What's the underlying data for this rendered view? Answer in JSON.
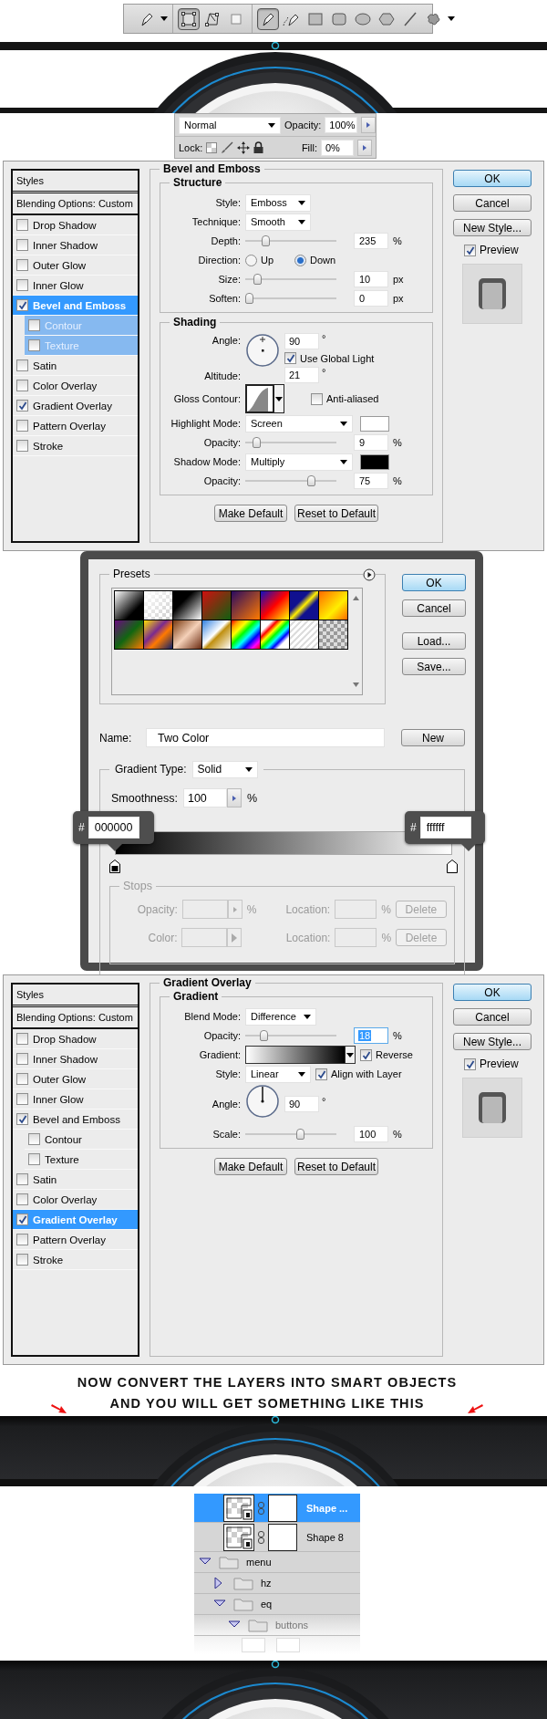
{
  "tool_options_bar": {
    "tool_groups": [
      {
        "tools": [
          {
            "kind": "pen-menu",
            "selected": false
          }
        ]
      },
      {
        "tools": [
          {
            "kind": "shape-layers",
            "selected": true
          },
          {
            "kind": "paths",
            "selected": false
          },
          {
            "kind": "fill-pixels",
            "selected": false
          }
        ]
      },
      {
        "tools": [
          {
            "kind": "pen",
            "selected": true
          },
          {
            "kind": "freeform-pen",
            "selected": false
          },
          {
            "kind": "rectangle",
            "selected": false
          },
          {
            "kind": "rounded-rectangle",
            "selected": false
          },
          {
            "kind": "ellipse",
            "selected": false
          },
          {
            "kind": "polygon",
            "selected": false
          },
          {
            "kind": "line",
            "selected": false
          },
          {
            "kind": "custom-shape",
            "selected": false
          }
        ]
      }
    ]
  },
  "layer_options": {
    "blend_mode": "Normal",
    "opacity_label": "Opacity:",
    "opacity": "100%",
    "lock_label": "Lock:",
    "fill_label": "Fill:",
    "fill": "0%"
  },
  "bevel_dialog": {
    "styles_title": "Styles",
    "blending_options": "Blending Options: Custom",
    "effects": [
      {
        "label": "Drop Shadow",
        "checked": false,
        "selected": false
      },
      {
        "label": "Inner Shadow",
        "checked": false,
        "selected": false
      },
      {
        "label": "Outer Glow",
        "checked": false,
        "selected": false
      },
      {
        "label": "Inner Glow",
        "checked": false,
        "selected": false
      },
      {
        "label": "Bevel and Emboss",
        "checked": true,
        "selected": true,
        "children": [
          {
            "label": "Contour",
            "checked": false,
            "selected": false
          },
          {
            "label": "Texture",
            "checked": false,
            "selected": false
          }
        ]
      },
      {
        "label": "Satin",
        "checked": false,
        "selected": false
      },
      {
        "label": "Color Overlay",
        "checked": false,
        "selected": false
      },
      {
        "label": "Gradient Overlay",
        "checked": true,
        "selected": false
      },
      {
        "label": "Pattern Overlay",
        "checked": false,
        "selected": false
      },
      {
        "label": "Stroke",
        "checked": false,
        "selected": false
      }
    ],
    "panel_title": "Bevel and Emboss",
    "groups": [
      {
        "title": "Structure",
        "rows": [
          {
            "kind": "select",
            "label": "Style:",
            "value": "Emboss"
          },
          {
            "kind": "select",
            "label": "Technique:",
            "value": "Smooth"
          },
          {
            "kind": "slider",
            "label": "Depth:",
            "level": 0.2,
            "value": "235",
            "unit": "%",
            "value_selected": false
          },
          {
            "kind": "radio",
            "label": "Direction:",
            "options": [
              {
                "label": "Up",
                "selected": false
              },
              {
                "label": "Down",
                "selected": true
              }
            ]
          },
          {
            "kind": "slider",
            "label": "Size:",
            "level": 0.1,
            "value": "10",
            "unit": "px",
            "value_selected": false
          },
          {
            "kind": "slider",
            "label": "Soften:",
            "level": 0,
            "value": "0",
            "unit": "px",
            "value_selected": false
          }
        ]
      },
      {
        "title": "Shading",
        "rows": [
          {
            "kind": "angle",
            "label": "Angle:",
            "value": "90",
            "unit": "°",
            "check": {
              "label": "Use Global Light",
              "checked": true
            },
            "altitude_label": "Altitude:",
            "altitude": "21",
            "altitude_unit": "°"
          },
          {
            "kind": "contour",
            "label": "Gloss Contour:",
            "check": {
              "label": "Anti-aliased",
              "checked": false
            }
          },
          {
            "kind": "select-color",
            "label": "Highlight Mode:",
            "value": "Screen",
            "color": "#ffffff"
          },
          {
            "kind": "slider",
            "label": "Opacity:",
            "level": 0.09,
            "value": "9",
            "unit": "%",
            "value_selected": false
          },
          {
            "kind": "select-color",
            "label": "Shadow Mode:",
            "value": "Multiply",
            "color": "#000000"
          },
          {
            "kind": "slider",
            "label": "Opacity:",
            "level": 0.75,
            "value": "75",
            "unit": "%",
            "value_selected": false
          }
        ]
      }
    ],
    "panel_buttons": [
      "Make Default",
      "Reset to Default"
    ],
    "buttons": [
      {
        "label": "OK",
        "default": true
      },
      {
        "label": "Cancel",
        "default": false
      },
      {
        "label": "New Style...",
        "default": false
      }
    ],
    "preview": {
      "label": "Preview",
      "checked": true
    }
  },
  "gradient_editor": {
    "presets_title": "Presets",
    "buttons": [
      {
        "label": "OK",
        "default": true
      },
      {
        "label": "Cancel",
        "default": false
      },
      {
        "label": "Load...",
        "default": false
      },
      {
        "label": "Save...",
        "default": false
      }
    ],
    "name_label": "Name:",
    "name": "Two Color",
    "new_button": "New",
    "type_label": "Gradient Type:",
    "type": "Solid",
    "smoothness_label": "Smoothness:",
    "smoothness": "100",
    "smoothness_unit": "%",
    "color_callouts": [
      {
        "hash": "#",
        "value": "000000",
        "color": "#000000"
      },
      {
        "hash": "#",
        "value": "ffffff",
        "color": "#ffffff"
      }
    ],
    "stops": {
      "title": "Stops",
      "disabled": true,
      "rows": [
        {
          "kind": "opacity",
          "label": "Opacity:",
          "unit": "%",
          "location_label": "Location:",
          "location_unit": "%",
          "button": "Delete"
        },
        {
          "kind": "color",
          "label": "Color:",
          "location_label": "Location:",
          "location_unit": "%",
          "button": "Delete"
        }
      ]
    }
  },
  "gradient_dialog": {
    "styles_title": "Styles",
    "blending_options": "Blending Options: Custom",
    "effects": [
      {
        "label": "Drop Shadow",
        "checked": false,
        "selected": false
      },
      {
        "label": "Inner Shadow",
        "checked": false,
        "selected": false
      },
      {
        "label": "Outer Glow",
        "checked": false,
        "selected": false
      },
      {
        "label": "Inner Glow",
        "checked": false,
        "selected": false
      },
      {
        "label": "Bevel and Emboss",
        "checked": true,
        "selected": false,
        "children": [
          {
            "label": "Contour",
            "checked": false,
            "selected": false
          },
          {
            "label": "Texture",
            "checked": false,
            "selected": false
          }
        ]
      },
      {
        "label": "Satin",
        "checked": false,
        "selected": false
      },
      {
        "label": "Color Overlay",
        "checked": false,
        "selected": false
      },
      {
        "label": "Gradient Overlay",
        "checked": true,
        "selected": true
      },
      {
        "label": "Pattern Overlay",
        "checked": false,
        "selected": false
      },
      {
        "label": "Stroke",
        "checked": false,
        "selected": false
      }
    ],
    "panel_title": "Gradient Overlay",
    "groups": [
      {
        "title": "Gradient",
        "rows": [
          {
            "kind": "select",
            "label": "Blend Mode:",
            "value": "Difference"
          },
          {
            "kind": "slider",
            "label": "Opacity:",
            "level": 0.18,
            "value": "18",
            "unit": "%",
            "value_selected": true
          },
          {
            "kind": "gradient",
            "label": "Gradient:",
            "check": {
              "label": "Reverse",
              "checked": true
            }
          },
          {
            "kind": "select-check",
            "label": "Style:",
            "value": "Linear",
            "check": {
              "label": "Align with Layer",
              "checked": true
            }
          },
          {
            "kind": "angle",
            "label": "Angle:",
            "value": "90",
            "unit": "°"
          },
          {
            "kind": "slider",
            "label": "Scale:",
            "level": 0.62,
            "value": "100",
            "unit": "%",
            "value_selected": false
          }
        ]
      }
    ],
    "panel_buttons": [
      "Make Default",
      "Reset to Default"
    ],
    "buttons": [
      {
        "label": "OK",
        "default": true
      },
      {
        "label": "Cancel",
        "default": false
      },
      {
        "label": "New Style...",
        "default": false
      }
    ],
    "preview": {
      "label": "Preview",
      "checked": true
    }
  },
  "caption": {
    "lines": [
      "NOW CONVERT THE LAYERS INTO SMART OBJECTS",
      "AND YOU WILL GET SOMETHING LIKE THIS"
    ]
  },
  "layers_panel": {
    "layers": [
      {
        "kind": "smart-object",
        "name": "Shape ...",
        "selected": true
      },
      {
        "kind": "smart-object",
        "name": "Shape 8",
        "selected": false
      },
      {
        "kind": "group",
        "name": "menu",
        "selected": false,
        "expanded": true,
        "children": [
          {
            "kind": "group",
            "name": "hz",
            "selected": false,
            "expanded": false
          },
          {
            "kind": "group",
            "name": "eq",
            "selected": false,
            "expanded": true,
            "children": [
              {
                "kind": "group",
                "name": "buttons",
                "selected": false,
                "expanded": true
              }
            ]
          }
        ]
      }
    ]
  }
}
